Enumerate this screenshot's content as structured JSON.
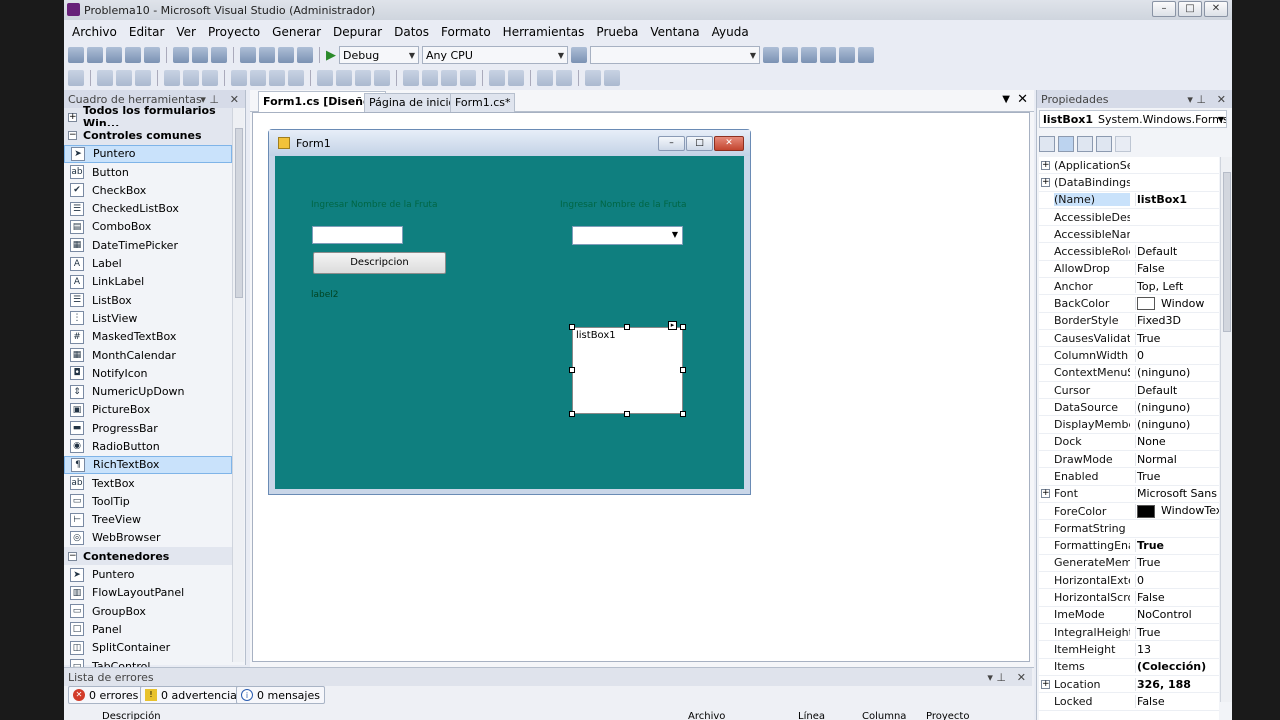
{
  "window": {
    "title": "Problema10 - Microsoft Visual Studio (Administrador)"
  },
  "menu": [
    "Archivo",
    "Editar",
    "Ver",
    "Proyecto",
    "Generar",
    "Depurar",
    "Datos",
    "Formato",
    "Herramientas",
    "Prueba",
    "Ventana",
    "Ayuda"
  ],
  "toolbar": {
    "config": "Debug",
    "platform": "Any CPU",
    "search": ""
  },
  "toolbox": {
    "title": "Cuadro de herramientas",
    "groups": [
      {
        "label": "Todos los formularios Win...",
        "expanded": false
      },
      {
        "label": "Controles comunes",
        "expanded": true
      }
    ],
    "items": [
      {
        "label": "Puntero",
        "icon": "pointer-icon",
        "glyph": "➤"
      },
      {
        "label": "Button",
        "icon": "button-icon",
        "glyph": "ab"
      },
      {
        "label": "CheckBox",
        "icon": "checkbox-icon",
        "glyph": "✔"
      },
      {
        "label": "CheckedListBox",
        "icon": "checkedlistbox-icon",
        "glyph": "☰"
      },
      {
        "label": "ComboBox",
        "icon": "combobox-icon",
        "glyph": "▤"
      },
      {
        "label": "DateTimePicker",
        "icon": "datetimepicker-icon",
        "glyph": "▦"
      },
      {
        "label": "Label",
        "icon": "label-icon",
        "glyph": "A"
      },
      {
        "label": "LinkLabel",
        "icon": "linklabel-icon",
        "glyph": "A"
      },
      {
        "label": "ListBox",
        "icon": "listbox-icon",
        "glyph": "☰"
      },
      {
        "label": "ListView",
        "icon": "listview-icon",
        "glyph": "⋮"
      },
      {
        "label": "MaskedTextBox",
        "icon": "maskedtextbox-icon",
        "glyph": "#"
      },
      {
        "label": "MonthCalendar",
        "icon": "monthcalendar-icon",
        "glyph": "▦"
      },
      {
        "label": "NotifyIcon",
        "icon": "notifyicon-icon",
        "glyph": "◘"
      },
      {
        "label": "NumericUpDown",
        "icon": "numericupdown-icon",
        "glyph": "⇕"
      },
      {
        "label": "PictureBox",
        "icon": "picturebox-icon",
        "glyph": "▣"
      },
      {
        "label": "ProgressBar",
        "icon": "progressbar-icon",
        "glyph": "▬"
      },
      {
        "label": "RadioButton",
        "icon": "radiobutton-icon",
        "glyph": "◉"
      },
      {
        "label": "RichTextBox",
        "icon": "richtextbox-icon",
        "glyph": "¶"
      },
      {
        "label": "TextBox",
        "icon": "textbox-icon",
        "glyph": "ab"
      },
      {
        "label": "ToolTip",
        "icon": "tooltip-icon",
        "glyph": "▭"
      },
      {
        "label": "TreeView",
        "icon": "treeview-icon",
        "glyph": "⊢"
      },
      {
        "label": "WebBrowser",
        "icon": "webbrowser-icon",
        "glyph": "◎"
      }
    ],
    "containers_label": "Contenedores",
    "containers": [
      {
        "label": "Puntero",
        "icon": "pointer-icon",
        "glyph": "➤"
      },
      {
        "label": "FlowLayoutPanel",
        "icon": "flowlayoutpanel-icon",
        "glyph": "▥"
      },
      {
        "label": "GroupBox",
        "icon": "groupbox-icon",
        "glyph": "▭"
      },
      {
        "label": "Panel",
        "icon": "panel-icon",
        "glyph": "□"
      },
      {
        "label": "SplitContainer",
        "icon": "splitcontainer-icon",
        "glyph": "◫"
      },
      {
        "label": "TabControl",
        "icon": "tabcontrol-icon",
        "glyph": "▭"
      }
    ]
  },
  "tabs": [
    {
      "label": "Form1.cs [Diseño]*",
      "active": true
    },
    {
      "label": "Página de inicio",
      "active": false
    },
    {
      "label": "Form1.cs*",
      "active": false
    }
  ],
  "form": {
    "title": "Form1",
    "backcolor": "#0f7f7f",
    "label1": "Ingresar Nombre de la Fruta",
    "label2": "Ingresar Nombre de la Fruta",
    "button": "Descripcion",
    "label3": "label2",
    "listbox": "listBox1"
  },
  "errors": {
    "title": "Lista de errores",
    "errors_label": "0 errores",
    "warnings_label": "0 advertencias",
    "messages_label": "0 mensajes",
    "columns": [
      "Descripción",
      "Archivo",
      "Línea",
      "Columna",
      "Proyecto"
    ]
  },
  "properties": {
    "title": "Propiedades",
    "object": "listBox1",
    "object_type": "System.Windows.Forms.Lis",
    "rows": [
      {
        "name": "(ApplicationSett",
        "value": "",
        "expandable": true
      },
      {
        "name": "(DataBindings)",
        "value": "",
        "expandable": true
      },
      {
        "name": "(Name)",
        "value": "listBox1",
        "bold": true,
        "selected": true
      },
      {
        "name": "AccessibleDescr",
        "value": ""
      },
      {
        "name": "AccessibleName",
        "value": ""
      },
      {
        "name": "AccessibleRole",
        "value": "Default"
      },
      {
        "name": "AllowDrop",
        "value": "False"
      },
      {
        "name": "Anchor",
        "value": "Top, Left"
      },
      {
        "name": "BackColor",
        "value": "Window",
        "swatch": "#ffffff"
      },
      {
        "name": "BorderStyle",
        "value": "Fixed3D"
      },
      {
        "name": "CausesValidatio",
        "value": "True"
      },
      {
        "name": "ColumnWidth",
        "value": "0"
      },
      {
        "name": "ContextMenuSt",
        "value": "(ninguno)"
      },
      {
        "name": "Cursor",
        "value": "Default"
      },
      {
        "name": "DataSource",
        "value": "(ninguno)"
      },
      {
        "name": "DisplayMember",
        "value": "(ninguno)"
      },
      {
        "name": "Dock",
        "value": "None"
      },
      {
        "name": "DrawMode",
        "value": "Normal"
      },
      {
        "name": "Enabled",
        "value": "True"
      },
      {
        "name": "Font",
        "value": "Microsoft Sans Se",
        "expandable": true
      },
      {
        "name": "ForeColor",
        "value": "WindowTex",
        "swatch": "#000000"
      },
      {
        "name": "FormatString",
        "value": ""
      },
      {
        "name": "FormattingEnab",
        "value": "True",
        "bold": true
      },
      {
        "name": "GenerateMembe",
        "value": "True"
      },
      {
        "name": "HorizontalExten",
        "value": "0"
      },
      {
        "name": "HorizontalScroll",
        "value": "False"
      },
      {
        "name": "ImeMode",
        "value": "NoControl"
      },
      {
        "name": "IntegralHeight",
        "value": "True"
      },
      {
        "name": "ItemHeight",
        "value": "13"
      },
      {
        "name": "Items",
        "value": "(Colección)",
        "bold": true
      },
      {
        "name": "Location",
        "value": "326, 188",
        "bold": true,
        "expandable": true
      },
      {
        "name": "Locked",
        "value": "False"
      }
    ]
  }
}
